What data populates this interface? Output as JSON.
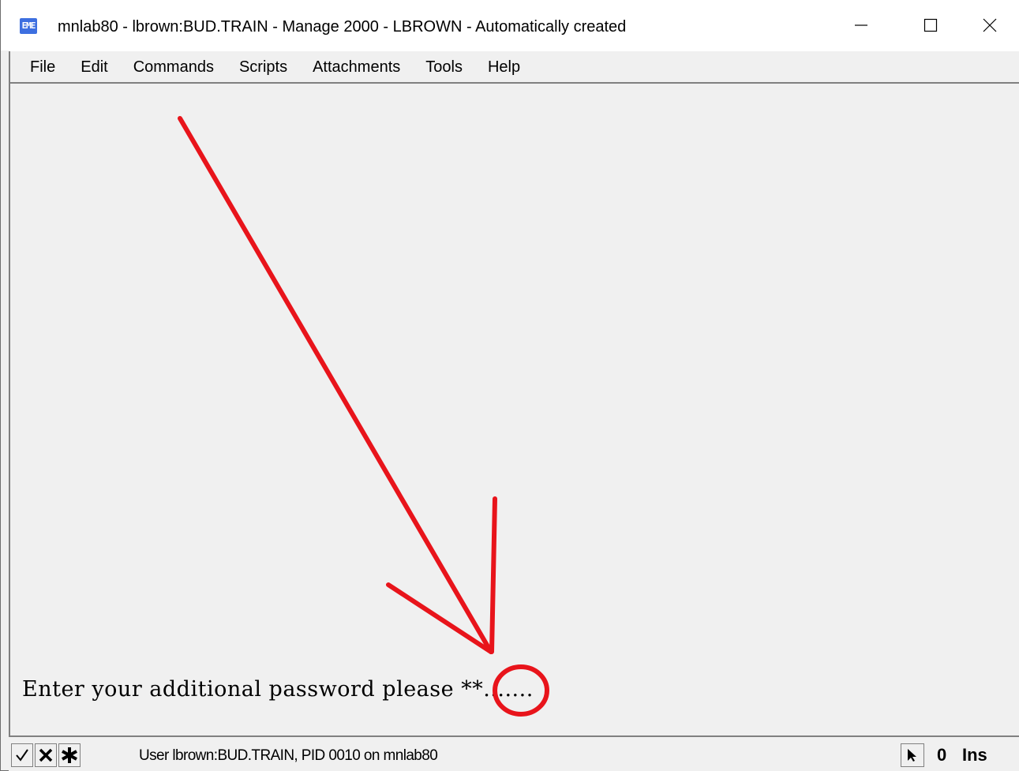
{
  "window": {
    "app_icon_text": "EME",
    "title": "mnlab80 - lbrown:BUD.TRAIN - Manage 2000 - LBROWN - Automatically created"
  },
  "menu": {
    "items": [
      "File",
      "Edit",
      "Commands",
      "Scripts",
      "Attachments",
      "Tools",
      "Help"
    ]
  },
  "terminal": {
    "prompt": "Enter your additional password please ",
    "entered": "**",
    "remaining": ".......",
    "annotation_color": "#e8141b"
  },
  "statusbar": {
    "ok_icon": "check-icon",
    "cancel_icon": "x-icon",
    "star_icon": "asterisk-icon",
    "status_text": "User lbrown:BUD.TRAIN, PID 0010 on mnlab80",
    "pointer_icon": "pointer-arrow-icon",
    "count": "0",
    "mode": "Ins"
  }
}
